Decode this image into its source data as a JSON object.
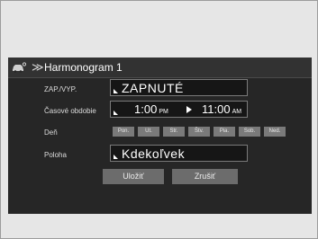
{
  "header": {
    "title": "Harmonogram 1",
    "chevrons": "≫"
  },
  "rows": {
    "onoff": {
      "label": "ZAP./VYP.",
      "value": "ZAPNUTÉ"
    },
    "time": {
      "label": "Časové obdobie",
      "start": "1:00",
      "start_ampm": "PM",
      "end": "11:00",
      "end_ampm": "AM"
    },
    "day": {
      "label": "Deň",
      "days": [
        "Pon.",
        "Ut.",
        "Str.",
        "Štv.",
        "Pia.",
        "Sob.",
        "Ned."
      ]
    },
    "location": {
      "label": "Poloha",
      "value": "Kdekoľvek"
    }
  },
  "buttons": {
    "save": "Uložiť",
    "cancel": "Zrušiť"
  },
  "icons": {
    "vehicle": "car-key-icon",
    "corner": "corner-triangle-icon",
    "arrow": "arrow-right-icon"
  },
  "colors": {
    "screen_bg": "#262626",
    "button_bg": "#6c6c6c",
    "text": "#ffffff"
  }
}
